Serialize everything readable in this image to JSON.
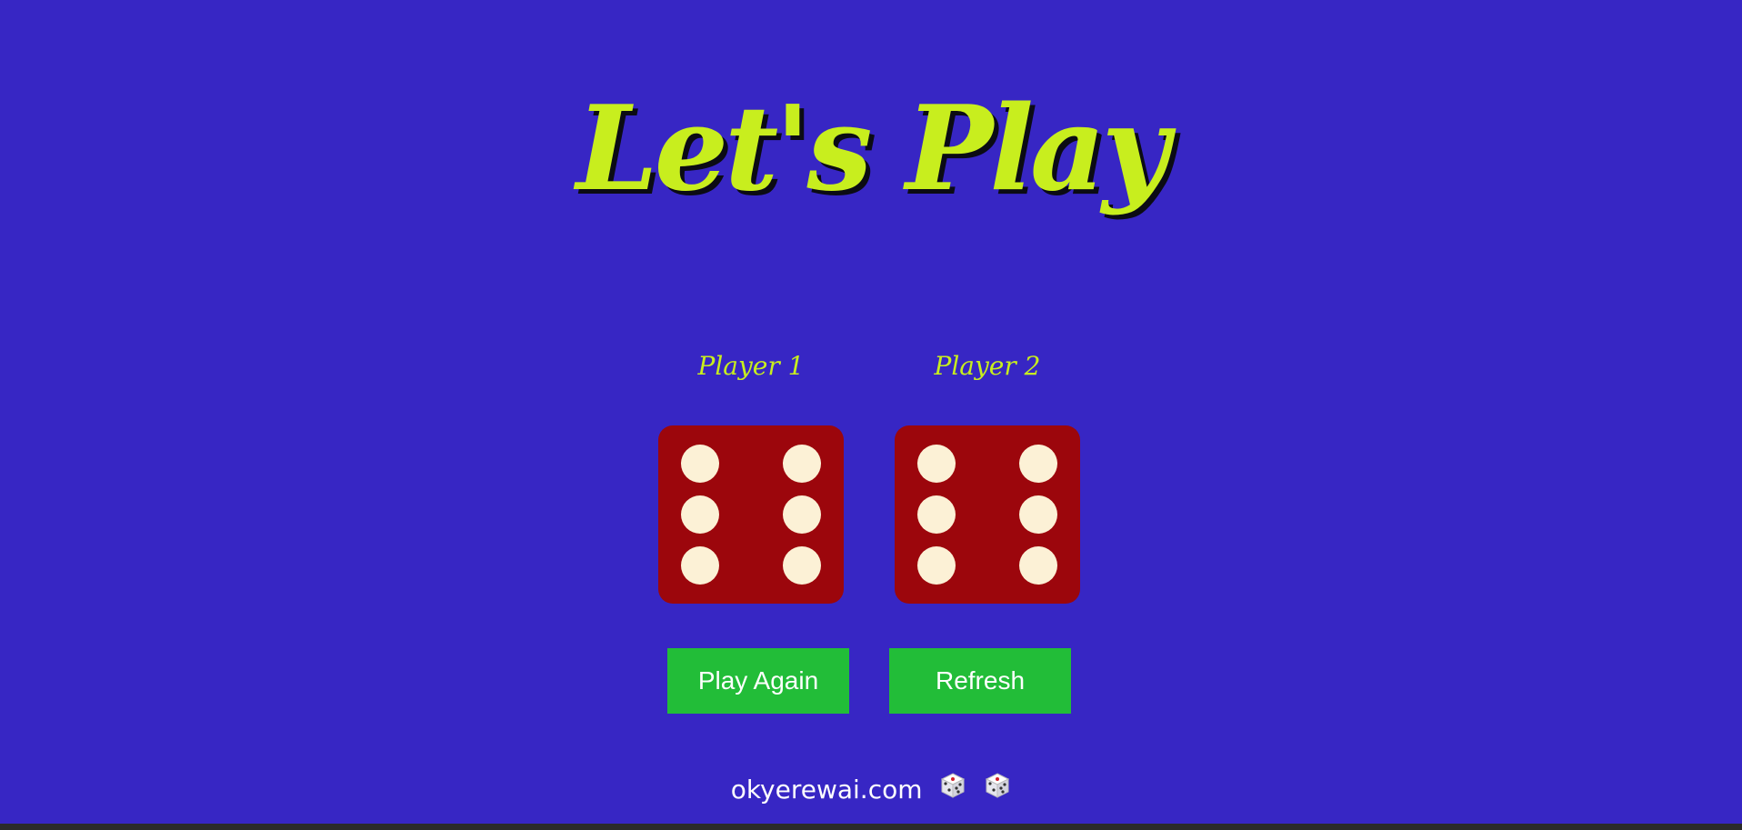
{
  "title": "Let's Play",
  "players": [
    {
      "label": "Player 1",
      "die_value": 6
    },
    {
      "label": "Player 2",
      "die_value": 6
    }
  ],
  "buttons": {
    "play_again": "Play Again",
    "refresh": "Refresh"
  },
  "footer": {
    "text": "okyerewai.com",
    "icons": [
      "game-die-icon",
      "game-die-icon"
    ]
  },
  "colors": {
    "background": "#3726c4",
    "title": "#c8ee1e",
    "die_face": "#9c060c",
    "pip": "#fcf1d6",
    "button": "#22bd38"
  }
}
